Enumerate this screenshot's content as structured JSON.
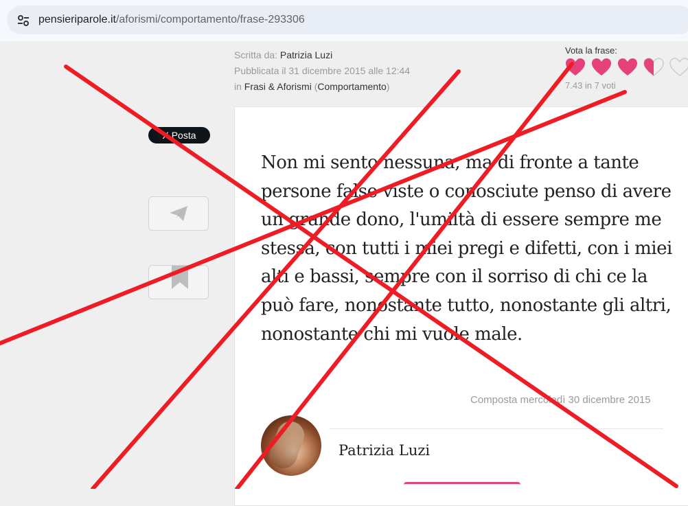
{
  "browser": {
    "url_domain": "pensieriparole.it",
    "url_path": "/aforismi/comportamento/frase-293306",
    "site_info_icon": "tune-icon"
  },
  "meta": {
    "written_by_label": "Scritta da:",
    "author": "Patrizia Luzi",
    "published": "Pubblicata il 31 dicembre 2015 alle 12:44",
    "in_label": "in",
    "category": "Frasi & Aforismi",
    "subcategory": "Comportamento"
  },
  "rating": {
    "label": "Vota la frase:",
    "value": 7.43,
    "summary": "7.43 in 7 voti",
    "hearts_max": 5,
    "hearts_filled": 3.5,
    "color": "#e6427a"
  },
  "share": {
    "x_label": "X Posta",
    "telegram_icon": "paper-plane-icon",
    "bookmark_icon": "bookmark-icon"
  },
  "quote": {
    "text": "Non mi sento nessuna, ma di fronte a tante persone false viste o conosciute penso di avere un grande dono, l'umiltà di essere sempre me stessa, con tutti i miei pregi e difetti, con i miei alti e bassi, sempre con il sorriso di chi ce la può fare, nonostante tutto, nonostante gli altri, nonostante chi mi vuole male.",
    "composed": "Composta mercoledì 30 dicembre 2015"
  },
  "author_box": {
    "name": "Patrizia Luzi",
    "avatar_icon": "avatar"
  },
  "overlay": {
    "color": "#ee1c25",
    "description_icon": "red-cross-marks"
  }
}
